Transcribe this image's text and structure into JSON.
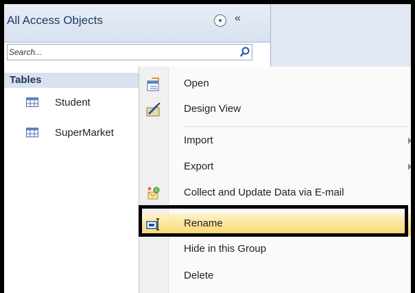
{
  "nav": {
    "title": "All Access Objects",
    "collapse_glyph": "«",
    "dropdown_glyph": "▾",
    "search_placeholder": "Search...",
    "group": "Tables",
    "tables": [
      "Student",
      "SuperMarket"
    ]
  },
  "menu": {
    "items": [
      {
        "label": "Open",
        "icon": "open-table-icon"
      },
      {
        "label": "Design View",
        "icon": "design-view-icon"
      },
      {
        "label": "Import",
        "submenu": true
      },
      {
        "label": "Export",
        "submenu": true
      },
      {
        "label": "Collect and Update Data via E-mail",
        "icon": "collect-data-icon"
      },
      {
        "label": "Rename",
        "icon": "rename-icon",
        "highlighted": true
      },
      {
        "label": "Hide in this Group"
      },
      {
        "label": "Delete"
      }
    ]
  },
  "colors": {
    "accent_highlight": "#f9d56c",
    "nav_text": "#1e3967",
    "pane_bg": "#d9e2ef"
  }
}
